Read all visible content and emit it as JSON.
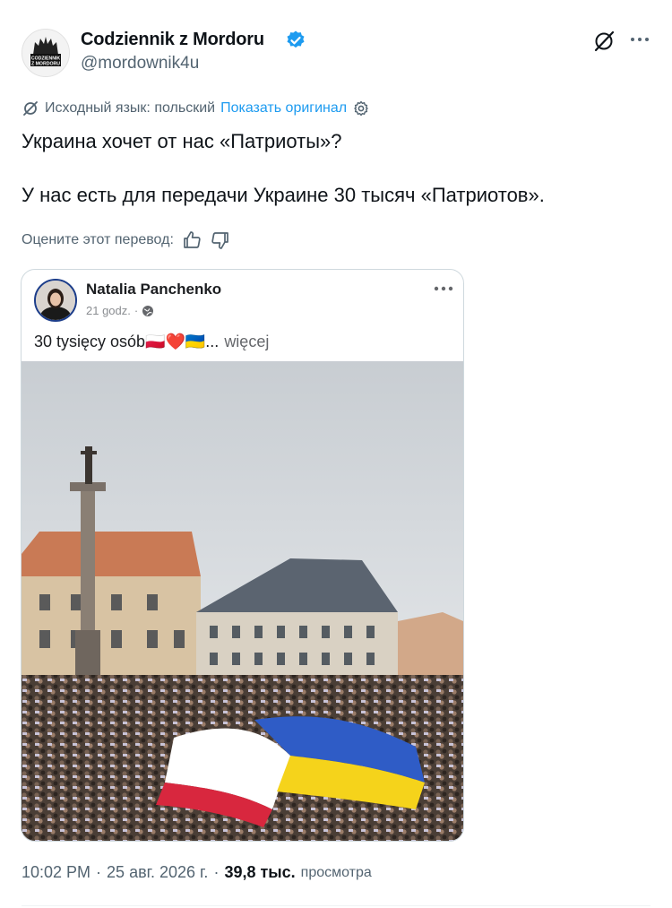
{
  "author": {
    "display_name": "Codziennik z Mordoru",
    "handle": "@mordownik4u",
    "avatar_text_top": "CODZIENNIK",
    "avatar_text_bottom": "Z MORDORU"
  },
  "translation": {
    "source_language": "Исходный язык: польский",
    "show_original": "Показать оригинал"
  },
  "tweet": {
    "line1": "Украина хочет от нас «Патриоты»?",
    "line2": "У нас есть для передачи Украине 30 тысяч «Патриотов»."
  },
  "rating": {
    "label": "Оцените этот перевод:"
  },
  "embedded_post": {
    "author": "Natalia Panchenko",
    "time": "21 godz.",
    "separator": "·",
    "text": "30 tysięcy osób🇵🇱❤️🇺🇦...",
    "more_label": "więcej"
  },
  "footer": {
    "time": "10:02 PM",
    "date": "25 авг. 2026 г.",
    "separator1": "·",
    "separator2": "·",
    "views_count": "39,8 тыс.",
    "views_label": "просмотра"
  },
  "colors": {
    "accent": "#1d9bf0",
    "text": "#0f1419",
    "secondary": "#536471",
    "border": "#cfd9de"
  }
}
